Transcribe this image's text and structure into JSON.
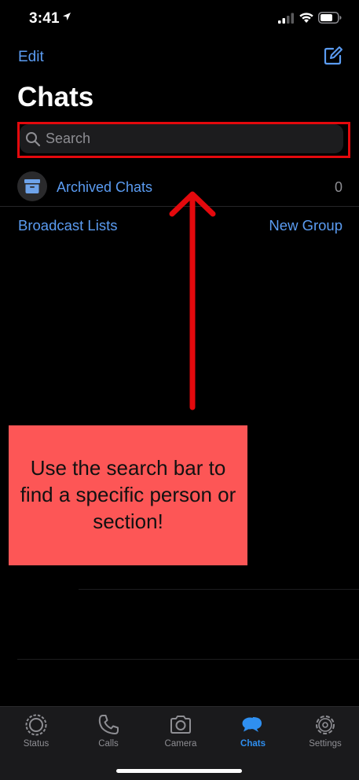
{
  "status_bar": {
    "time": "3:41"
  },
  "nav": {
    "edit_label": "Edit",
    "title": "Chats"
  },
  "search": {
    "placeholder": "Search"
  },
  "archived": {
    "label": "Archived Chats",
    "count": "0"
  },
  "links": {
    "broadcast": "Broadcast Lists",
    "new_group": "New Group"
  },
  "annotation": {
    "text": "Use the search bar to find a specific person or section!",
    "arrow_color": "#e4090d",
    "box_color": "#fd5656"
  },
  "tabs": [
    {
      "label": "Status",
      "icon": "status-icon"
    },
    {
      "label": "Calls",
      "icon": "phone-icon"
    },
    {
      "label": "Camera",
      "icon": "camera-icon"
    },
    {
      "label": "Chats",
      "icon": "chats-icon",
      "active": true
    },
    {
      "label": "Settings",
      "icon": "gear-icon"
    }
  ],
  "colors": {
    "accent": "#5b9cf2",
    "active_tab": "#2f8ff0",
    "highlight": "#e4090d"
  }
}
